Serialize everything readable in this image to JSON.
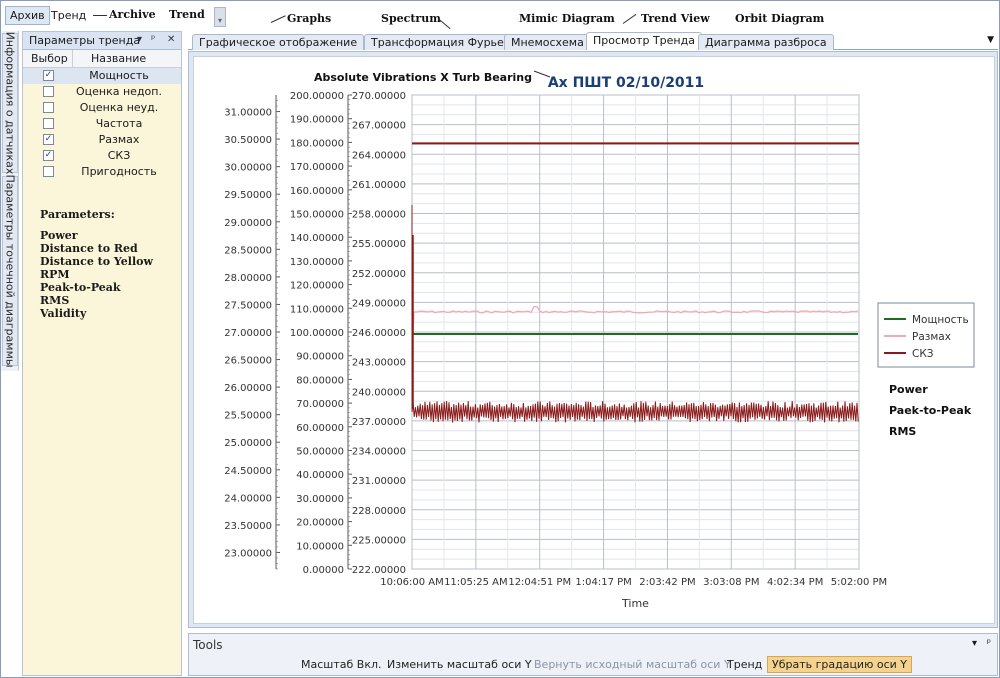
{
  "menu": {
    "items": [
      {
        "label": "Архив"
      },
      {
        "label": "Тренд"
      }
    ]
  },
  "annotations": {
    "archive": "Archive",
    "trend": "Trend",
    "graphs": "Graphs",
    "spectrum": "Spectrum",
    "mimic": "Mimic Diagram",
    "trend_view": "Trend View",
    "orbit": "Orbit Diagram",
    "chart_title": "Absolute Vibrations X Turb Bearing",
    "legend_power": "Power",
    "legend_p2p": "Paek-to-Peak",
    "legend_rms": "RMS"
  },
  "side_tabs": [
    {
      "label": "Информация о датчиках"
    },
    {
      "label": "Параметры точечной диаграммы"
    }
  ],
  "left_panel": {
    "title": "Параметры тренда",
    "columns": {
      "select": "Выбор",
      "name": "Название"
    },
    "rows": [
      {
        "name": "Мощность",
        "checked": true,
        "selected": true
      },
      {
        "name": "Оценка недоп.",
        "checked": false
      },
      {
        "name": "Оценка неуд.",
        "checked": false
      },
      {
        "name": "Частота",
        "checked": false
      },
      {
        "name": "Размах",
        "checked": true
      },
      {
        "name": "СКЗ",
        "checked": true
      },
      {
        "name": "Пригодность",
        "checked": false
      }
    ],
    "params_header": "Parameters:",
    "params": [
      "Power",
      "Distance to Red",
      "Distance to Yellow",
      "RPM",
      "Peak-to-Peak",
      "RMS",
      "Validity"
    ]
  },
  "tabs": [
    {
      "label": "Графическое отображение",
      "active": false
    },
    {
      "label": "Трансформация Фурье",
      "active": false
    },
    {
      "label": "Мнемосхема",
      "active": false
    },
    {
      "label": "Просмотр Тренда",
      "active": true
    },
    {
      "label": "Диаграмма разброса",
      "active": false
    }
  ],
  "tools": {
    "title": "Tools",
    "buttons": [
      {
        "label": "Масштаб Вкл.",
        "state": "normal"
      },
      {
        "label": "Изменить масштаб оси Y",
        "state": "normal"
      },
      {
        "label": "Вернуть исходный масштаб оси Y",
        "state": "disabled"
      },
      {
        "label": "Тренд",
        "state": "normal"
      },
      {
        "label": "Убрать градацию оси Y",
        "state": "highlighted"
      }
    ]
  },
  "chart_data": {
    "type": "line",
    "title": "Ax ПШТ 02/10/2011",
    "xlabel": "Time",
    "x_ticks": [
      "10:06:00 AM",
      "11:05:25 AM",
      "12:04:51 PM",
      "1:04:17 PM",
      "2:03:42 PM",
      "3:03:08 PM",
      "4:02:34 PM",
      "5:02:00 PM"
    ],
    "y_axes": [
      {
        "ticks": [
          "31.00000",
          "30.50000",
          "30.00000",
          "29.50000",
          "29.00000",
          "28.50000",
          "28.00000",
          "27.50000",
          "27.00000",
          "26.50000",
          "26.00000",
          "25.50000",
          "25.00000",
          "24.50000",
          "24.00000",
          "23.50000",
          "23.00000"
        ],
        "ylim": [
          22.7,
          31.3
        ]
      },
      {
        "ticks": [
          "200.00000",
          "190.00000",
          "180.00000",
          "170.00000",
          "160.00000",
          "150.00000",
          "140.00000",
          "130.00000",
          "120.00000",
          "110.00000",
          "100.00000",
          "90.00000",
          "80.00000",
          "70.00000",
          "60.00000",
          "50.00000",
          "40.00000",
          "30.00000",
          "20.00000",
          "10.00000",
          "0.00000"
        ],
        "ylim": [
          0,
          200
        ]
      },
      {
        "ticks": [
          "270.00000",
          "267.00000",
          "264.00000",
          "261.00000",
          "258.00000",
          "255.00000",
          "252.00000",
          "249.00000",
          "246.00000",
          "243.00000",
          "240.00000",
          "237.00000",
          "234.00000",
          "231.00000",
          "228.00000",
          "225.00000",
          "222.00000"
        ],
        "ylim": [
          222,
          270
        ]
      }
    ],
    "series": [
      {
        "name": "Мощность",
        "color": "#1f6b1f",
        "axis": 2,
        "value": 245.8
      },
      {
        "name": "Размах",
        "color": "#f1a9b6",
        "axis": 1,
        "value": 108.5
      },
      {
        "name": "СКЗ",
        "color": "#8b1a1a",
        "axis": 0,
        "value": 25.55,
        "noise": 0.13
      }
    ],
    "reference_lines": [
      {
        "axis": 2,
        "value": 265.1,
        "color": "#8b1a1a"
      }
    ],
    "legend_position": "right"
  }
}
